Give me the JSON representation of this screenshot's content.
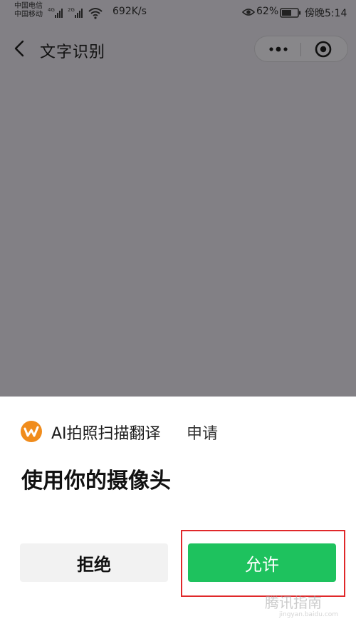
{
  "status_bar": {
    "carrier_1": "中国电信",
    "carrier_2": "中国移动",
    "signal_1_label": "4G",
    "signal_2_label": "2G",
    "network_speed": "692K/s",
    "battery_percent": "62%",
    "battery_level": 0.62,
    "time": "傍晚5:14"
  },
  "nav": {
    "title": "文字识别"
  },
  "permission_sheet": {
    "app_name": "AI拍照扫描翻译",
    "request_word": "申请",
    "permission_text": "使用你的摄像头",
    "deny_label": "拒绝",
    "allow_label": "允许"
  },
  "watermark": {
    "text": "腾讯指南",
    "url": "jingyan.baidu.com"
  },
  "colors": {
    "overlay": "#828085",
    "allow_green": "#1ec25e",
    "highlight_red": "#e0282a",
    "logo_orange": "#f08c1c"
  },
  "icons": [
    "back-arrow-icon",
    "more-dots-icon",
    "close-target-icon",
    "eye-icon",
    "battery-icon",
    "wifi-icon",
    "signal-icon",
    "app-logo-icon"
  ]
}
